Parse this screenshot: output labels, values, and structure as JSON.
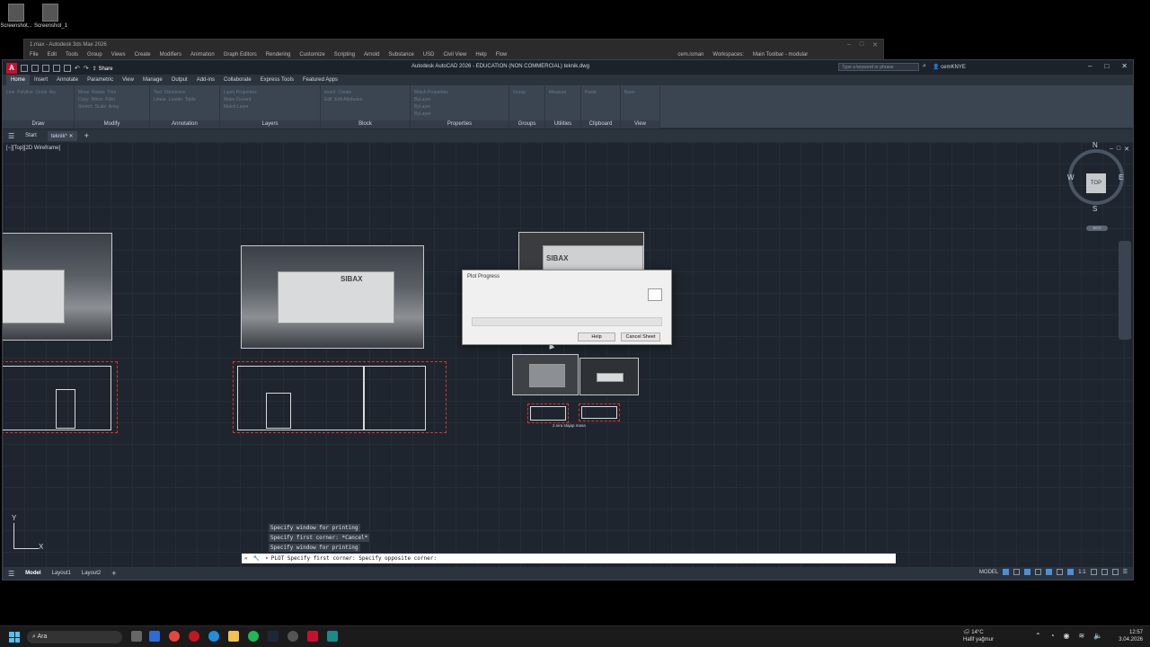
{
  "desktop": {
    "icons": [
      "Screenshot...",
      "Screenshot_1"
    ]
  },
  "max_window": {
    "title": "1.max - Autodesk 3ds Max 2026",
    "menu": [
      "File",
      "Edit",
      "Tools",
      "Group",
      "Views",
      "Create",
      "Modifiers",
      "Animation",
      "Graph Editors",
      "Rendering",
      "Customize",
      "Scripting",
      "Arnold",
      "Substance",
      "USD",
      "Civil View",
      "Help",
      "Flow"
    ],
    "user": "cem.isman",
    "workspaces_label": "Workspaces:",
    "workspace": "Main Toolbar - modular"
  },
  "autocad": {
    "share_label": "Share",
    "title": "Autodesk AutoCAD 2026 - EDUCATION (NON COMMERCIAL)    teknik.dwg",
    "search_placeholder": "Type a keyword or phrase",
    "user": "cemKNYE",
    "ribbon_tabs": [
      "Home",
      "Insert",
      "Annotate",
      "Parametric",
      "View",
      "Manage",
      "Output",
      "Add-ins",
      "Collaborate",
      "Express Tools",
      "Featured Apps"
    ],
    "active_tab": "Home",
    "panels": [
      {
        "label": "Draw",
        "tools": "Line  Polyline  Circle  Arc"
      },
      {
        "label": "Modify",
        "tools": "Move  Rotate  Trim\nCopy  Mirror  Fillet\nStretch  Scale  Array"
      },
      {
        "label": "Annotation",
        "tools": "Text  Dimension\nLinear  Leader  Table"
      },
      {
        "label": "Layers",
        "tools": "Layer Properties\nMake Current\nMatch Layer"
      },
      {
        "label": "Block",
        "tools": "Insert  Create\nEdit  Edit Attributes"
      },
      {
        "label": "Properties",
        "tools": "Match Properties\nByLayer\nByLayer\nByLayer"
      },
      {
        "label": "Groups",
        "tools": "Group"
      },
      {
        "label": "Utilities",
        "tools": "Measure"
      },
      {
        "label": "Clipboard",
        "tools": "Paste"
      },
      {
        "label": "View",
        "tools": "Base"
      }
    ],
    "file_tabs": [
      "Start",
      "teknik*"
    ],
    "viewport_label": "[−][Top][2D Wireframe]",
    "viewcube": {
      "n": "N",
      "s": "S",
      "e": "E",
      "w": "W",
      "face": "TOP",
      "wcs": "WCS"
    },
    "ucs": {
      "x": "X",
      "y": "Y"
    },
    "brand": "SIBAX",
    "drawing_note": "2.sıra stajap masa",
    "command_history": [
      "Specify window for printing",
      "Specify first corner: *Cancel*",
      "Specify window for printing"
    ],
    "command_line": "PLOT Specify first corner: Specify opposite corner:",
    "layout_tabs": [
      "Model",
      "Layout1",
      "Layout2"
    ],
    "status_model": "MODEL",
    "status_scale": "1:1"
  },
  "dialog": {
    "title": "Plot Progress",
    "progress_percent": 0,
    "help_label": "Help",
    "cancel_label": "Cancel Sheet"
  },
  "taskbar": {
    "search": "Ara",
    "weather_temp": "14°C",
    "weather_desc": "Hafif yağmur",
    "time": "12:57",
    "date": "3.04.2026"
  }
}
